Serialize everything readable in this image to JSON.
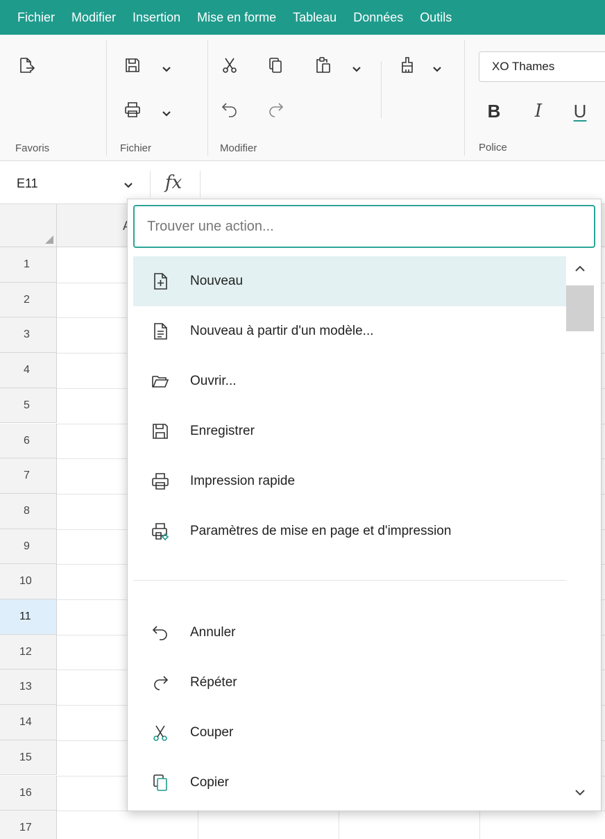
{
  "menubar": {
    "items": [
      "Fichier",
      "Modifier",
      "Insertion",
      "Mise en forme",
      "Tableau",
      "Données",
      "Outils"
    ]
  },
  "ribbon": {
    "groups": {
      "favoris": "Favoris",
      "fichier": "Fichier",
      "modifier": "Modifier",
      "police": "Police"
    },
    "font_name": "XO Thames",
    "bold": "B",
    "italic": "I",
    "underline": "U"
  },
  "formula_bar": {
    "cell_ref": "E11",
    "fx": "fx"
  },
  "grid": {
    "column_visible": "A",
    "rows": [
      "1",
      "2",
      "3",
      "4",
      "5",
      "6",
      "7",
      "8",
      "9",
      "10",
      "11",
      "12",
      "13",
      "14",
      "15",
      "16",
      "17"
    ],
    "selected_row": "11"
  },
  "popup": {
    "search_placeholder": "Trouver une action...",
    "actions": [
      {
        "label": "Nouveau",
        "icon": "new-document-icon",
        "highlighted": true
      },
      {
        "label": "Nouveau à partir d'un modèle...",
        "icon": "template-document-icon"
      },
      {
        "label": "Ouvrir...",
        "icon": "open-folder-icon"
      },
      {
        "label": "Enregistrer",
        "icon": "save-icon"
      },
      {
        "label": "Impression rapide",
        "icon": "printer-icon"
      },
      {
        "label": "Paramètres de mise en page et d'impression",
        "icon": "print-settings-icon"
      },
      {
        "label": "Annuler",
        "icon": "undo-icon"
      },
      {
        "label": "Répéter",
        "icon": "redo-icon"
      },
      {
        "label": "Couper",
        "icon": "cut-icon"
      },
      {
        "label": "Copier",
        "icon": "copy-icon"
      }
    ]
  },
  "colors": {
    "accent": "#1f9b8c",
    "highlight": "#e3f1f2",
    "selected_row": "#dfeefb"
  }
}
